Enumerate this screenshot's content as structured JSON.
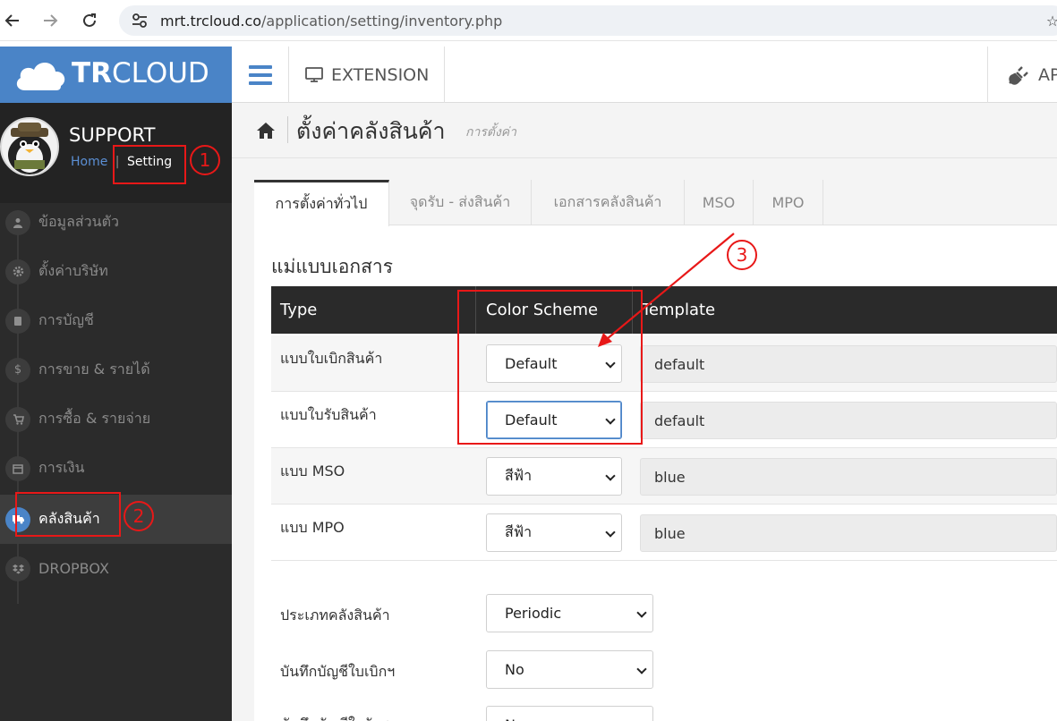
{
  "browser": {
    "url_host": "mrt.trcloud.co",
    "url_path": "/application/setting/inventory.php"
  },
  "sidebar": {
    "logo_bold": "TR",
    "logo_rest": "CLOUD",
    "user": {
      "name": "SUPPORT",
      "home_link": "Home",
      "separator": "|",
      "setting_link": "Setting"
    },
    "items": [
      {
        "label": "ข้อมูลส่วนตัว",
        "icon": "user-icon"
      },
      {
        "label": "ตั้งค่าบริษัท",
        "icon": "gear-icon"
      },
      {
        "label": "การบัญชี",
        "icon": "book-icon"
      },
      {
        "label": "การขาย & รายได้",
        "icon": "dollar-icon"
      },
      {
        "label": "การซื้อ & รายจ่าย",
        "icon": "cart-icon"
      },
      {
        "label": "การเงิน",
        "icon": "calendar-icon"
      },
      {
        "label": "คลังสินค้า",
        "icon": "truck-icon",
        "active": true
      },
      {
        "label": "DROPBOX",
        "icon": "dropbox-icon"
      }
    ]
  },
  "topnav": {
    "extension_label": "EXTENSION",
    "api_label": "API"
  },
  "page": {
    "title": "ตั้งค่าคลังสินค้า",
    "subtitle": "การตั้งค่า"
  },
  "tabs": [
    {
      "label": "การตั้งค่าทั่วไป",
      "active": true
    },
    {
      "label": "จุดรับ - ส่งสินค้า"
    },
    {
      "label": "เอกสารคลังสินค้า"
    },
    {
      "label": "MSO"
    },
    {
      "label": "MPO"
    }
  ],
  "doc_template": {
    "section_title": "แม่แบบเอกสาร",
    "headers": {
      "type": "Type",
      "color_scheme": "Color Scheme",
      "template": "Template"
    },
    "rows": [
      {
        "type": "แบบใบเบิกสินค้า",
        "color_scheme": "Default",
        "template": "default"
      },
      {
        "type": "แบบใบรับสินค้า",
        "color_scheme": "Default",
        "template": "default"
      },
      {
        "type": "แบบ MSO",
        "color_scheme": "สีฟ้า",
        "template": "blue"
      },
      {
        "type": "แบบ MPO",
        "color_scheme": "สีฟ้า",
        "template": "blue"
      }
    ]
  },
  "settings": [
    {
      "label": "ประเภทคลังสินค้า",
      "value": "Periodic"
    },
    {
      "label": "บันทึกบัญชีใบเบิกฯ",
      "value": "No"
    },
    {
      "label": "บันทึกบัญชีใบรับฯ",
      "value": "No"
    }
  ],
  "annotations": [
    "1",
    "2",
    "3"
  ],
  "colors": {
    "accent": "#4a84c7",
    "sidebar_bg": "#2b2b2b",
    "annotation_red": "#e81818"
  }
}
